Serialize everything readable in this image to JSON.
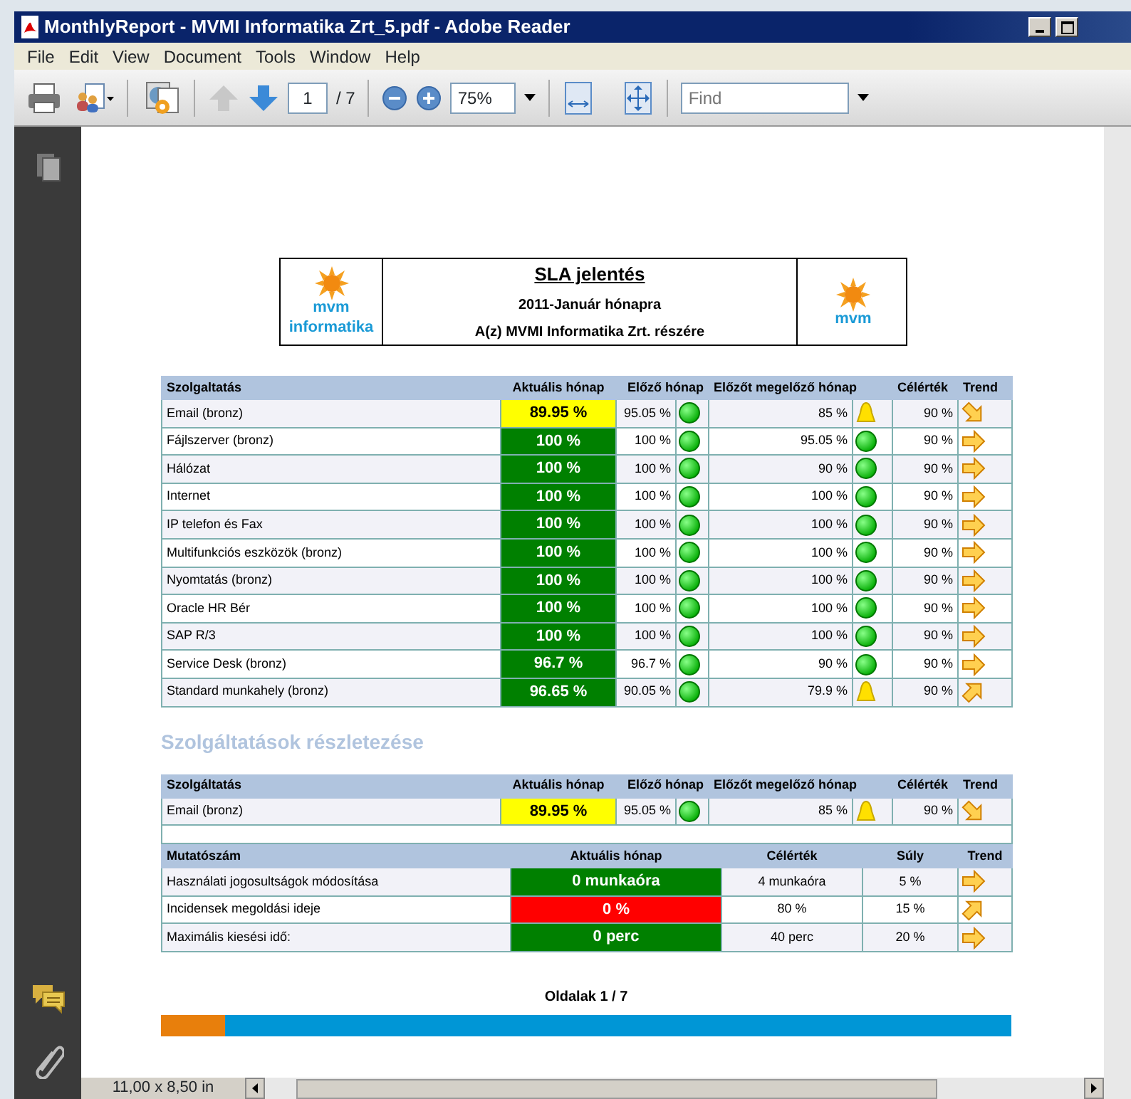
{
  "window": {
    "title": "MonthlyReport - MVMI Informatika Zrt_5.pdf - Adobe Reader"
  },
  "menu": [
    "File",
    "Edit",
    "View",
    "Document",
    "Tools",
    "Window",
    "Help"
  ],
  "toolbar": {
    "page": "1",
    "page_total": "/ 7",
    "zoom": "75%",
    "find_placeholder": "Find"
  },
  "report": {
    "logos": [
      {
        "mark": "mvm",
        "caption": "informatika"
      },
      {
        "mark": "mvm"
      }
    ],
    "title": "SLA jelentés",
    "subtitle": "2011-Január hónapra",
    "recipient": "A(z) MVMI Informatika Zrt. részére"
  },
  "sla_table": {
    "columns": [
      "Szolgaltatás",
      "Aktuális hónap",
      "Előző hónap",
      "Előzőt megelőző hónap",
      "Célérték",
      "Trend"
    ],
    "rows": [
      {
        "service": "Email (bronz)",
        "current": "89.95 %",
        "color": "#ffff00",
        "prev": {
          "text": "95.05 %",
          "kind": "ok"
        },
        "prev2": {
          "text": "85 %",
          "kind": "warning"
        },
        "target": "90 %",
        "trend": {
          "kind": "down"
        }
      },
      {
        "service": "Fájlszerver (bronz)",
        "current": "100 %",
        "color": "#008000",
        "prev": {
          "text": "100 %",
          "kind": "ok"
        },
        "prev2": {
          "text": "95.05 %",
          "kind": "ok"
        },
        "target": "90 %",
        "trend": {
          "kind": "flat"
        }
      },
      {
        "service": "Hálózat",
        "current": "100 %",
        "color": "#008000",
        "prev": {
          "text": "100 %",
          "kind": "ok"
        },
        "prev2": {
          "text": "90 %",
          "kind": "ok"
        },
        "target": "90 %",
        "trend": {
          "kind": "flat"
        }
      },
      {
        "service": "Internet",
        "current": "100 %",
        "color": "#008000",
        "prev": {
          "text": "100 %",
          "kind": "ok"
        },
        "prev2": {
          "text": "100 %",
          "kind": "ok"
        },
        "target": "90 %",
        "trend": {
          "kind": "flat"
        }
      },
      {
        "service": "IP telefon és Fax",
        "current": "100 %",
        "color": "#008000",
        "prev": {
          "text": "100 %",
          "kind": "ok"
        },
        "prev2": {
          "text": "100 %",
          "kind": "ok"
        },
        "target": "90 %",
        "trend": {
          "kind": "flat"
        }
      },
      {
        "service": "Multifunkciós eszközök (bronz)",
        "current": "100 %",
        "color": "#008000",
        "prev": {
          "text": "100 %",
          "kind": "ok"
        },
        "prev2": {
          "text": "100 %",
          "kind": "ok"
        },
        "target": "90 %",
        "trend": {
          "kind": "flat"
        }
      },
      {
        "service": "Nyomtatás (bronz)",
        "current": "100 %",
        "color": "#008000",
        "prev": {
          "text": "100 %",
          "kind": "ok"
        },
        "prev2": {
          "text": "100 %",
          "kind": "ok"
        },
        "target": "90 %",
        "trend": {
          "kind": "flat"
        }
      },
      {
        "service": "Oracle HR Bér",
        "current": "100 %",
        "color": "#008000",
        "prev": {
          "text": "100 %",
          "kind": "ok"
        },
        "prev2": {
          "text": "100 %",
          "kind": "ok"
        },
        "target": "90 %",
        "trend": {
          "kind": "flat"
        }
      },
      {
        "service": "SAP R/3",
        "current": "100 %",
        "color": "#008000",
        "prev": {
          "text": "100 %",
          "kind": "ok"
        },
        "prev2": {
          "text": "100 %",
          "kind": "ok"
        },
        "target": "90 %",
        "trend": {
          "kind": "flat"
        }
      },
      {
        "service": "Service Desk (bronz)",
        "current": "96.7 %",
        "color": "#008000",
        "prev": {
          "text": "96.7 %",
          "kind": "ok"
        },
        "prev2": {
          "text": "90 %",
          "kind": "ok"
        },
        "target": "90 %",
        "trend": {
          "kind": "flat"
        }
      },
      {
        "service": "Standard munkahely (bronz)",
        "current": "96.65 %",
        "color": "#008000",
        "prev": {
          "text": "90.05 %",
          "kind": "ok"
        },
        "prev2": {
          "text": "79.9 %",
          "kind": "warning"
        },
        "target": "90 %",
        "trend": {
          "kind": "up"
        }
      }
    ]
  },
  "details_heading": "Szolgáltatások részletezése",
  "detail_table": {
    "columns": [
      "Szolgáltatás",
      "Aktuális hónap",
      "Előző hónap",
      "Előzőt megelőző hónap",
      "Célérték",
      "Trend"
    ],
    "rows": [
      {
        "service": "Email (bronz)",
        "current": "89.95 %",
        "color": "#ffff00",
        "prev": {
          "text": "95.05 %",
          "kind": "ok"
        },
        "prev2": {
          "text": "85 %",
          "kind": "warning"
        },
        "target": "90 %",
        "trend": {
          "kind": "down"
        }
      }
    ]
  },
  "metrics_table": {
    "columns": [
      "Mutatószám",
      "Aktuális hónap",
      "Célérték",
      "Súly",
      "Trend"
    ],
    "rows": [
      {
        "name": "Használati jogosultságok módosítása",
        "current": "0 munkaóra",
        "color": "#008000",
        "target": "4 munkaóra",
        "weight": "5 %",
        "trend": {
          "kind": "flat"
        }
      },
      {
        "name": "Incidensek megoldási ideje",
        "current": "0 %",
        "color": "#ff0000",
        "target": "80 %",
        "weight": "15 %",
        "trend": {
          "kind": "up"
        }
      },
      {
        "name": "Maximális kiesési idő:",
        "current": "0 perc",
        "color": "#008000",
        "target": "40 perc",
        "weight": "20 %",
        "trend": {
          "kind": "flat"
        }
      }
    ]
  },
  "footer": {
    "pages": "Oldalak 1 / 7",
    "level": 0.075
  },
  "status_bar": {
    "page_size": "11,00 x 8,50 in"
  }
}
